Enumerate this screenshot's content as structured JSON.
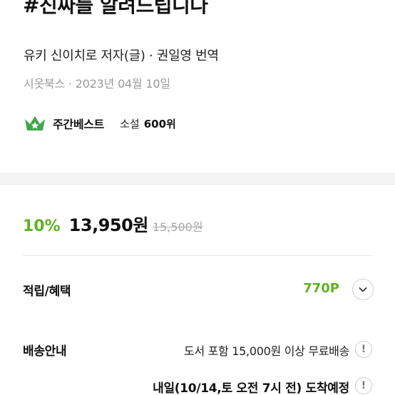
{
  "book": {
    "title": "#진짜를 알려드립니다",
    "authors": "유키 신이치로 저자(글) · 권일영 번역",
    "publisher_date": "시옷북스 · 2023년 04월 10일"
  },
  "bestseller": {
    "label": "주간베스트",
    "category": "소설",
    "rank": "600위",
    "crown_color": "#3fa84a"
  },
  "price": {
    "discount": "10%",
    "sale_price": "13,950원",
    "original_price": "15,500원",
    "accent_color": "#5fb223"
  },
  "benefits": {
    "label": "적립/혜택",
    "points": "770P",
    "toggle_icon": "chevron-down-icon"
  },
  "shipping": {
    "label": "배송안내",
    "free_shipping": "도서 포함 15,000원 이상 무료배송",
    "arrival": "내일(10/14,토 오전 7시 전) 도착예정",
    "info_icon": "info-icon"
  }
}
